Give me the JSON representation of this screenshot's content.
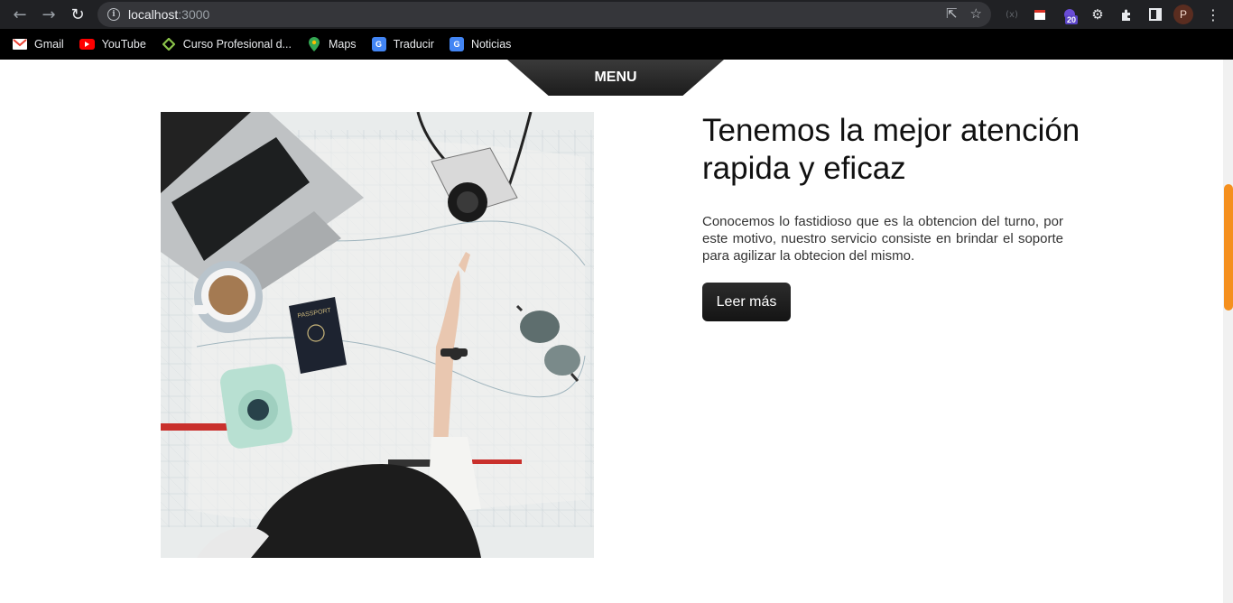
{
  "browser": {
    "url_host": "localhost",
    "url_port": ":3000",
    "profile_initial": "P",
    "extension_badge": "20"
  },
  "bookmarks": [
    {
      "label": "Gmail",
      "icon": "gmail-icon"
    },
    {
      "label": "YouTube",
      "icon": "youtube-icon"
    },
    {
      "label": "Curso Profesional d...",
      "icon": "course-icon"
    },
    {
      "label": "Maps",
      "icon": "maps-icon"
    },
    {
      "label": "Traducir",
      "icon": "translate-icon"
    },
    {
      "label": "Noticias",
      "icon": "news-icon"
    }
  ],
  "page": {
    "menu_label": "MENU",
    "heading": "Tenemos la mejor atención rapida y eficaz",
    "paragraph": "Conocemos lo fastidioso que es la obtencion del turno, por este motivo, nuestro servicio consiste en brindar el soporte para agilizar la obtecion del mismo.",
    "button_label": "Leer más",
    "image_subject": "travel-map-flatlay",
    "passport_text": "PASSPORT"
  },
  "colors": {
    "accent_scroll": "#f5901e",
    "dark": "#1c1c1c"
  }
}
